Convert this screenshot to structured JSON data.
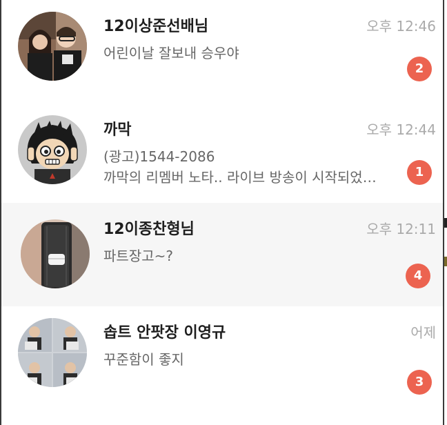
{
  "chats": [
    {
      "name": "12이상준선배님",
      "time": "오후 12:46",
      "preview": [
        "어린이날 잘보내 승우야"
      ],
      "unread": "2",
      "avatar": "photo-two-people-avatar"
    },
    {
      "name": "까막",
      "time": "오후 12:44",
      "preview": [
        "(광고)1544-2086",
        "까막의 리멤버 노타.. 라이브 방송이 시작되었…"
      ],
      "unread": "1",
      "avatar": "cartoon-character-avatar"
    },
    {
      "name": "12이종찬형님",
      "time": "오후 12:11",
      "preview": [
        "파트장고~?"
      ],
      "unread": "4",
      "avatar": "earbuds-case-avatar"
    },
    {
      "name": "솝트 안팟장 이영규",
      "time": "어제",
      "preview": [
        "꾸준함이 좋지"
      ],
      "unread": "3",
      "avatar": "photo-grid-avatar"
    }
  ],
  "colors": {
    "badge": "#ec6350",
    "selected_row": "#f6f6f6",
    "name": "#1e1e1e",
    "time": "#aaaaaa",
    "preview": "#666666"
  }
}
